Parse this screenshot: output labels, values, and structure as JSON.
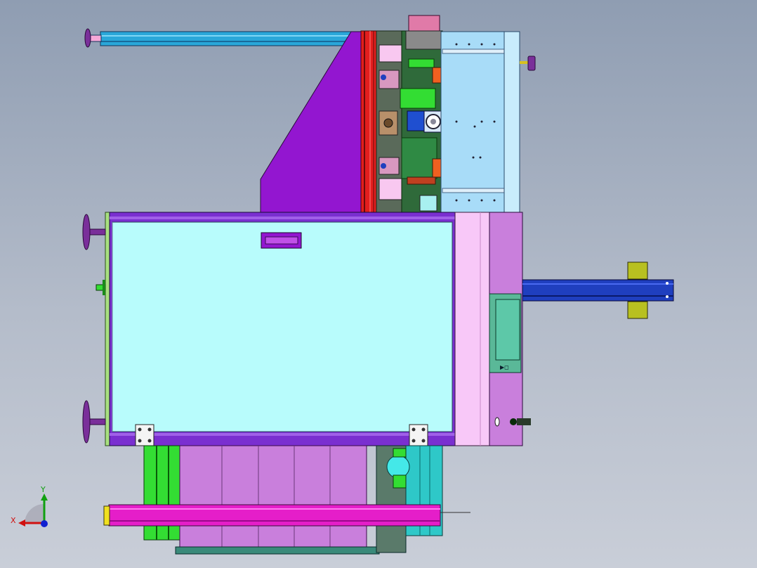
{
  "viewport": {
    "type": "CAD assembly view (top view)",
    "background_top": "#8f9db2",
    "background_bottom": "#c9ced8"
  },
  "axis_triad": {
    "x_label": "X",
    "y_label": "Y",
    "x_color": "#d01010",
    "y_color": "#10a010",
    "z_color": "#1020d0"
  },
  "control_panel": {
    "button_label": "▶◻"
  },
  "colors": {
    "cabinet_face": "#b8fcfc",
    "frame_purple": "#7a2fd0",
    "gusset": "#9316d0",
    "rail_red": "#e21e1e",
    "light_panel": "#a8dcf8",
    "magenta_bar": "#e51ec9",
    "lavender": "#c97fdc",
    "blue_arm": "#1f3fbf",
    "green": "#33dd33"
  }
}
